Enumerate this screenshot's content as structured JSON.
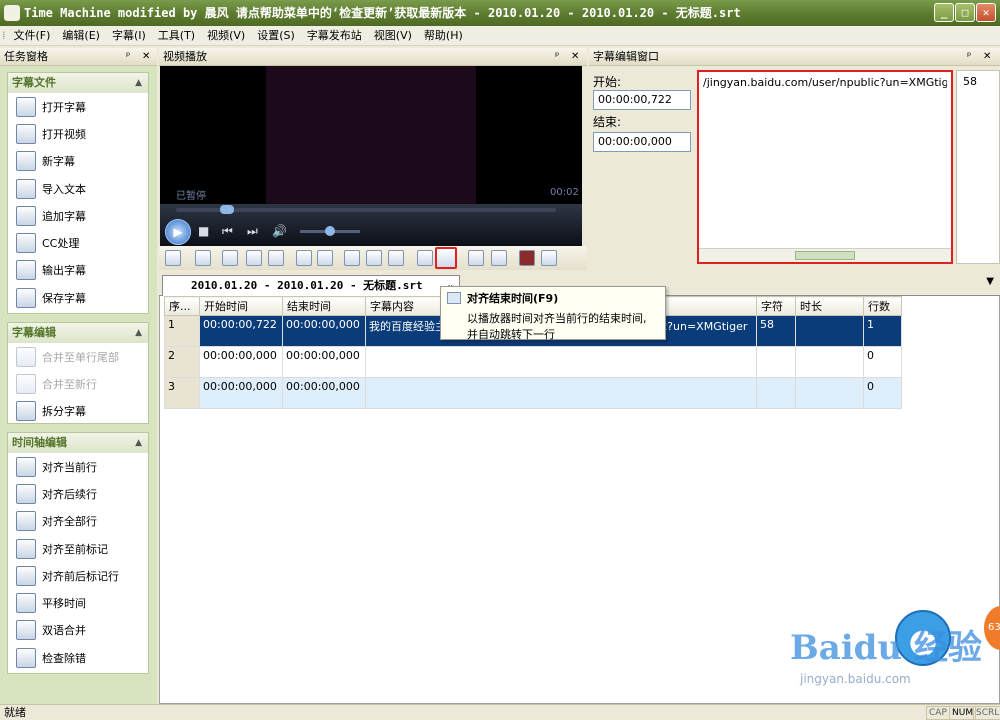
{
  "window": {
    "title": "Time Machine modified by 晨风 请点帮助菜单中的‘检查更新’获取最新版本 - 2010.01.20 - 2010.01.20 - 无标题.srt",
    "min": "_",
    "max": "□",
    "close": "✕"
  },
  "menu": [
    "文件(F)",
    "编辑(E)",
    "字幕(I)",
    "工具(T)",
    "视频(V)",
    "设置(S)",
    "字幕发布站",
    "视图(V)",
    "帮助(H)"
  ],
  "taskpane": {
    "title": "任务窗格",
    "groups": [
      {
        "title": "字幕文件",
        "items": [
          {
            "label": "打开字幕",
            "enabled": true
          },
          {
            "label": "打开视频",
            "enabled": true
          },
          {
            "label": "新字幕",
            "enabled": true
          },
          {
            "label": "导入文本",
            "enabled": true
          },
          {
            "label": "追加字幕",
            "enabled": true
          },
          {
            "label": "CC处理",
            "enabled": true
          },
          {
            "label": "输出字幕",
            "enabled": true
          },
          {
            "label": "保存字幕",
            "enabled": true
          }
        ]
      },
      {
        "title": "字幕编辑",
        "items": [
          {
            "label": "合并至单行尾部",
            "enabled": false
          },
          {
            "label": "合并至新行",
            "enabled": false
          },
          {
            "label": "拆分字幕",
            "enabled": true
          }
        ]
      },
      {
        "title": "时间轴编辑",
        "items": [
          {
            "label": "对齐当前行",
            "enabled": true
          },
          {
            "label": "对齐后续行",
            "enabled": true
          },
          {
            "label": "对齐全部行",
            "enabled": true
          },
          {
            "label": "对齐至前标记",
            "enabled": true
          },
          {
            "label": "对齐前后标记行",
            "enabled": true
          },
          {
            "label": "平移时间",
            "enabled": true
          },
          {
            "label": "双语合并",
            "enabled": true
          },
          {
            "label": "检查除错",
            "enabled": true
          }
        ]
      }
    ]
  },
  "video": {
    "title": "视频播放",
    "status": "已暂停",
    "time": "00:02",
    "seek_progress": 0.13,
    "volume": 0.5
  },
  "editor": {
    "title": "字幕编辑窗口",
    "start_label": "开始:",
    "start_value": "00:00:00,722",
    "end_label": "结束:",
    "end_value": "00:00:00,000",
    "text": "/jingyan.baidu.com/user/npublic?un=XMGtiger",
    "char_count": "58"
  },
  "file_tab": "2010.01.20 - 2010.01.20 - 无标题.srt",
  "grid": {
    "columns": [
      "序...",
      "开始时间",
      "结束时间",
      "字幕内容",
      "字符",
      "时长",
      "行数"
    ],
    "rows": [
      {
        "idx": "1",
        "start": "00:00:00,722",
        "end": "00:00:00,000",
        "text": "我的百度经验主页 http://jingyan.baidu.com/user/npublic?un=XMGtiger",
        "chars": "58",
        "dur": "",
        "lines": "1",
        "state": "selected"
      },
      {
        "idx": "2",
        "start": "00:00:00,000",
        "end": "00:00:00,000",
        "text": "",
        "chars": "",
        "dur": "",
        "lines": "0",
        "state": "normal"
      },
      {
        "idx": "3",
        "start": "00:00:00,000",
        "end": "00:00:00,000",
        "text": "",
        "chars": "",
        "dur": "",
        "lines": "0",
        "state": "alt"
      }
    ]
  },
  "tooltip": {
    "title": "对齐结束时间(F9)",
    "line1": "以播放器时间对齐当前行的结束时间,",
    "line2": "并自动跳转下一行"
  },
  "status": {
    "text": "就绪",
    "cap": "CAP",
    "num": "NUM",
    "scrl": "SCRL"
  },
  "overlay": {
    "watermark": "Baidu 经验",
    "url": "jingyan.baidu.com",
    "badge": "63"
  },
  "colors": {
    "title_green": "#5e7d30",
    "selection": "#0b3c7a",
    "highlight_red": "#e02020"
  }
}
